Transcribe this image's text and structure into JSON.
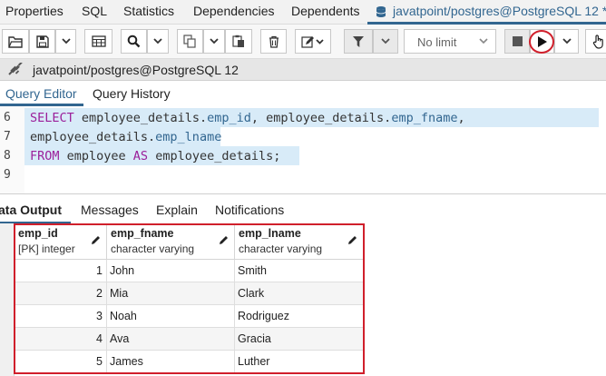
{
  "top_tabs": {
    "items": [
      "Properties",
      "SQL",
      "Statistics",
      "Dependencies",
      "Dependents"
    ],
    "active_label": "javatpoint/postgres@PostgreSQL 12 *"
  },
  "toolbar": {
    "limit_label": "No limit"
  },
  "connection": {
    "label": "javatpoint/postgres@PostgreSQL 12"
  },
  "editor_tabs": [
    "Query Editor",
    "Query History"
  ],
  "editor": {
    "lines": [
      {
        "num": "6",
        "parts": [
          [
            "kw",
            "SELECT"
          ],
          [
            "t",
            " employee_details."
          ],
          [
            "fld",
            "emp_id"
          ],
          [
            "t",
            ", employee_details."
          ],
          [
            "fld",
            "emp_fname"
          ],
          [
            "t",
            ","
          ]
        ]
      },
      {
        "num": "7",
        "parts": [
          [
            "t",
            "employee_details."
          ],
          [
            "fld",
            "emp_lname"
          ]
        ]
      },
      {
        "num": "8",
        "parts": [
          [
            "kw",
            "FROM"
          ],
          [
            "t",
            " employee "
          ],
          [
            "kw",
            "AS"
          ],
          [
            "t",
            " employee_details;"
          ]
        ]
      },
      {
        "num": "9",
        "parts": []
      }
    ]
  },
  "output_tabs": [
    "Data Output",
    "Messages",
    "Explain",
    "Notifications"
  ],
  "output_tabs_visible": [
    "ata Output",
    "Messages",
    "Explain",
    "Notifications"
  ],
  "grid": {
    "columns": [
      {
        "name": "emp_id",
        "type": "[PK] integer"
      },
      {
        "name": "emp_fname",
        "type": "character varying"
      },
      {
        "name": "emp_lname",
        "type": "character varying"
      }
    ],
    "rows": [
      [
        "1",
        "John",
        "Smith"
      ],
      [
        "2",
        "Mia",
        "Clark"
      ],
      [
        "3",
        "Noah",
        "Rodriguez"
      ],
      [
        "4",
        "Ava",
        "Gracia"
      ],
      [
        "5",
        "James",
        "Luther"
      ]
    ]
  },
  "colors": {
    "accent": "#326690",
    "keyword": "#9b1f9a",
    "highlight": "#d8ebf8",
    "annotation_red": "#d01f2b"
  }
}
